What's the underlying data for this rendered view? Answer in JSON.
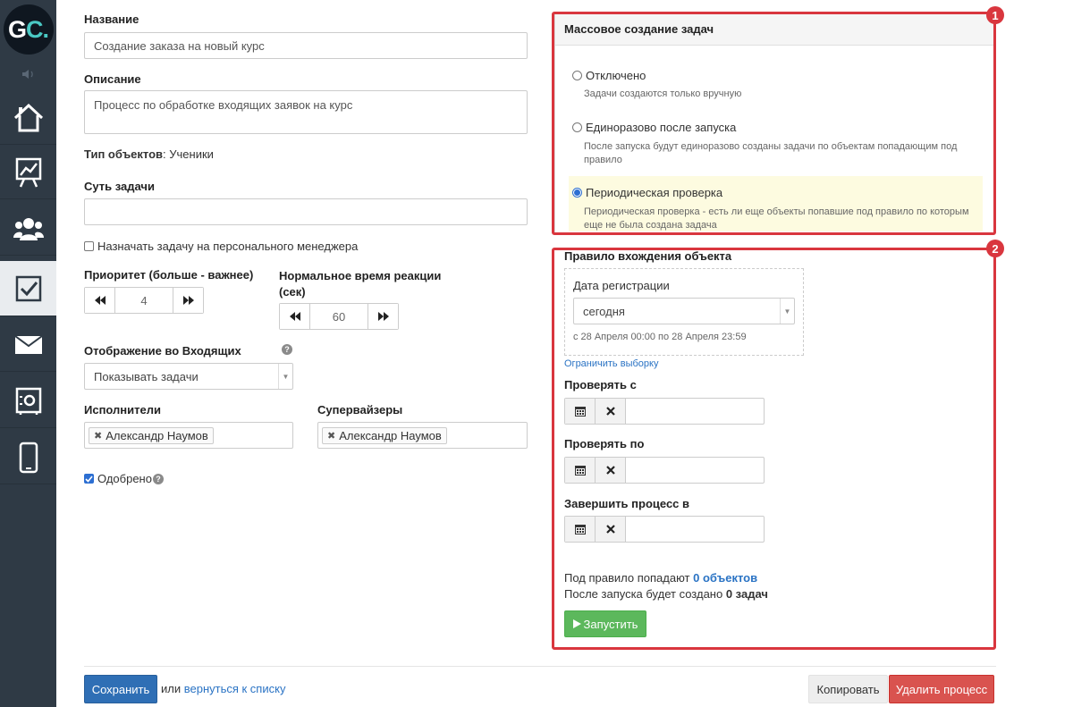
{
  "sidebar": {
    "logo": {
      "g": "G",
      "c": "C",
      "dot": "."
    },
    "items": [
      {
        "icon": "home-icon"
      },
      {
        "icon": "chart-icon"
      },
      {
        "icon": "users-icon"
      },
      {
        "icon": "tasks-icon",
        "active": true
      },
      {
        "icon": "mail-icon"
      },
      {
        "icon": "safe-icon"
      },
      {
        "icon": "mobile-icon"
      }
    ]
  },
  "form": {
    "name_label": "Название",
    "name_value": "Создание заказа на новый курс",
    "description_label": "Описание",
    "description_value": "Процесс по обработке входящих заявок на курс",
    "object_type_label": "Тип объектов",
    "object_type_value": ": Ученики",
    "task_essence_label": "Суть задачи",
    "task_essence_value": "",
    "assign_manager_label": "Назначать задачу на персонального менеджера",
    "priority_label": "Приоритет (больше - важнее)",
    "priority_value": "4",
    "reaction_label": "Нормальное время реакции (сек)",
    "reaction_value": "60",
    "inbox_label": "Отображение во Входящих",
    "inbox_value": "Показывать задачи",
    "executors_label": "Исполнители",
    "executor_tag": "Александр Наумов",
    "supervisors_label": "Супервайзеры",
    "supervisor_tag": "Александр Наумов",
    "approved_label": "Одобрено",
    "help_char": "?"
  },
  "mass": {
    "badge": "1",
    "title": "Массовое создание задач",
    "options": [
      {
        "label": "Отключено",
        "hint": "Задачи создаются только вручную",
        "selected": false
      },
      {
        "label": "Единоразово после запуска",
        "hint": "После запуска будут единоразово созданы задачи по объектам попадающим под правило",
        "selected": false
      },
      {
        "label": "Периодическая проверка",
        "hint": "Периодическая проверка - есть ли еще объекты попавшие под правило по которым еще не была создана задача",
        "selected": true
      }
    ]
  },
  "rule": {
    "badge": "2",
    "title": "Правило вхождения объекта",
    "reg_date_label": "Дата регистрации",
    "reg_date_value": "сегодня",
    "date_range": "с 28 Апреля 00:00 по 28 Апреля 23:59",
    "limit_link": "Ограничить выборку",
    "check_from_label": "Проверять с",
    "check_to_label": "Проверять по",
    "finish_label": "Завершить процесс в",
    "matches_prefix": "Под правило попадают ",
    "matches_link": "0 объектов",
    "created_prefix": "После запуска будет создано ",
    "created_value": "0 задач",
    "run_button": "Запустить"
  },
  "footer": {
    "save": "Сохранить",
    "or": "или",
    "back_link": "вернуться к списку",
    "copy": "Копировать",
    "delete": "Удалить процесс"
  },
  "colors": {
    "sidebar": "#2f3a45",
    "accent_red": "#d9363e",
    "link": "#2a73c4",
    "green": "#5cb85c"
  }
}
